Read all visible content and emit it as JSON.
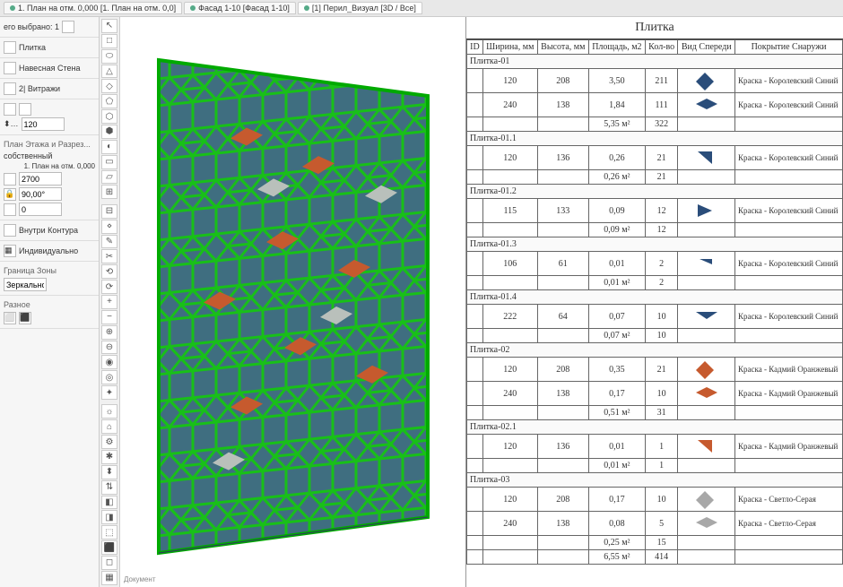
{
  "tabs": [
    {
      "label": "1. План на отм. 0,000 [1. План на отм. 0,0]",
      "active": false
    },
    {
      "label": "Фасад 1-10 [Фасад 1-10]",
      "active": false
    },
    {
      "label": "[1] Перил_Визуал [3D / Все]",
      "active": true
    }
  ],
  "left": {
    "selinfo": "его выбрано: 1",
    "tool": "Плитка",
    "wall": "Навесная Стена",
    "layer_label": "2| Витражи",
    "dim1": "120",
    "plan_section": "План Этажа и Разрез...",
    "own": "собственный",
    "planref": "1. План на отм. 0,000",
    "dim2": "2700",
    "angle_lock": "90,00°",
    "dim3": "0",
    "inside": "Внутри Контура",
    "individual": "Индивидуально",
    "zone": "Граница Зоны",
    "mirror": "Зеркально",
    "misc": "Разное",
    "doc": "Документ"
  },
  "table": {
    "title": "Плитка",
    "headers": [
      "ID",
      "Ширина, мм",
      "Высота, мм",
      "Площадь, м2",
      "Кол-во",
      "Вид Спереди",
      "Покрытие Снаружи"
    ],
    "groups": [
      {
        "id": "Плитка-01",
        "rows": [
          {
            "w": "120",
            "h": "208",
            "a": "3,50",
            "q": "211",
            "shape": "rhom-blue",
            "coat": "Краска - Королевский Синий"
          },
          {
            "w": "240",
            "h": "138",
            "a": "1,84",
            "q": "111",
            "shape": "rhom-blue-wide",
            "coat": "Краска - Королевский Синий"
          }
        ],
        "sum_a": "5,35 м²",
        "sum_q": "322"
      },
      {
        "id": "Плитка-01.1",
        "rows": [
          {
            "w": "120",
            "h": "136",
            "a": "0,26",
            "q": "21",
            "shape": "tri-blue-r",
            "coat": "Краска - Королевский Синий"
          }
        ],
        "sum_a": "0,26 м²",
        "sum_q": "21"
      },
      {
        "id": "Плитка-01.2",
        "rows": [
          {
            "w": "115",
            "h": "133",
            "a": "0,09",
            "q": "12",
            "shape": "tri-blue-play",
            "coat": "Краска - Королевский Синий"
          }
        ],
        "sum_a": "0,09 м²",
        "sum_q": "12"
      },
      {
        "id": "Плитка-01.3",
        "rows": [
          {
            "w": "106",
            "h": "61",
            "a": "0,01",
            "q": "2",
            "shape": "tri-blue-s",
            "coat": "Краска - Королевский Синий"
          }
        ],
        "sum_a": "0,01 м²",
        "sum_q": "2"
      },
      {
        "id": "Плитка-01.4",
        "rows": [
          {
            "w": "222",
            "h": "64",
            "a": "0,07",
            "q": "10",
            "shape": "tri-blue-down",
            "coat": "Краска - Королевский Синий"
          }
        ],
        "sum_a": "0,07 м²",
        "sum_q": "10"
      },
      {
        "id": "Плитка-02",
        "rows": [
          {
            "w": "120",
            "h": "208",
            "a": "0,35",
            "q": "21",
            "shape": "rhom-orange",
            "coat": "Краска - Кадмий Оранжевый"
          },
          {
            "w": "240",
            "h": "138",
            "a": "0,17",
            "q": "10",
            "shape": "rhom-orange-wide",
            "coat": "Краска - Кадмий Оранжевый"
          }
        ],
        "sum_a": "0,51 м²",
        "sum_q": "31"
      },
      {
        "id": "Плитка-02.1",
        "rows": [
          {
            "w": "120",
            "h": "136",
            "a": "0,01",
            "q": "1",
            "shape": "tri-orange-r",
            "coat": "Краска - Кадмий Оранжевый"
          }
        ],
        "sum_a": "0,01 м²",
        "sum_q": "1"
      },
      {
        "id": "Плитка-03",
        "rows": [
          {
            "w": "120",
            "h": "208",
            "a": "0,17",
            "q": "10",
            "shape": "rhom-grey",
            "coat": "Краска - Светло-Серая"
          },
          {
            "w": "240",
            "h": "138",
            "a": "0,08",
            "q": "5",
            "shape": "rhom-grey-wide",
            "coat": "Краска - Светло-Серая"
          }
        ],
        "sum_a": "0,25 м²",
        "sum_q": "15"
      }
    ],
    "grand_a": "6,55 м²",
    "grand_q": "414"
  },
  "tools": [
    "↖",
    "□",
    "⬭",
    "△",
    "◇",
    "⬠",
    "⬡",
    "⬢",
    "◐",
    "▭",
    "▱",
    "⊞",
    "⊟",
    "⋄",
    "✎",
    "✂",
    "⟲",
    "⟳",
    "+",
    "−",
    "⊕",
    "⊖",
    "◉",
    "◎",
    "✦",
    "☼",
    "⌂",
    "⚙",
    "✱",
    "⬍",
    "⇅",
    "◧",
    "◨",
    "⬚",
    "⬛",
    "◻",
    "▦"
  ]
}
